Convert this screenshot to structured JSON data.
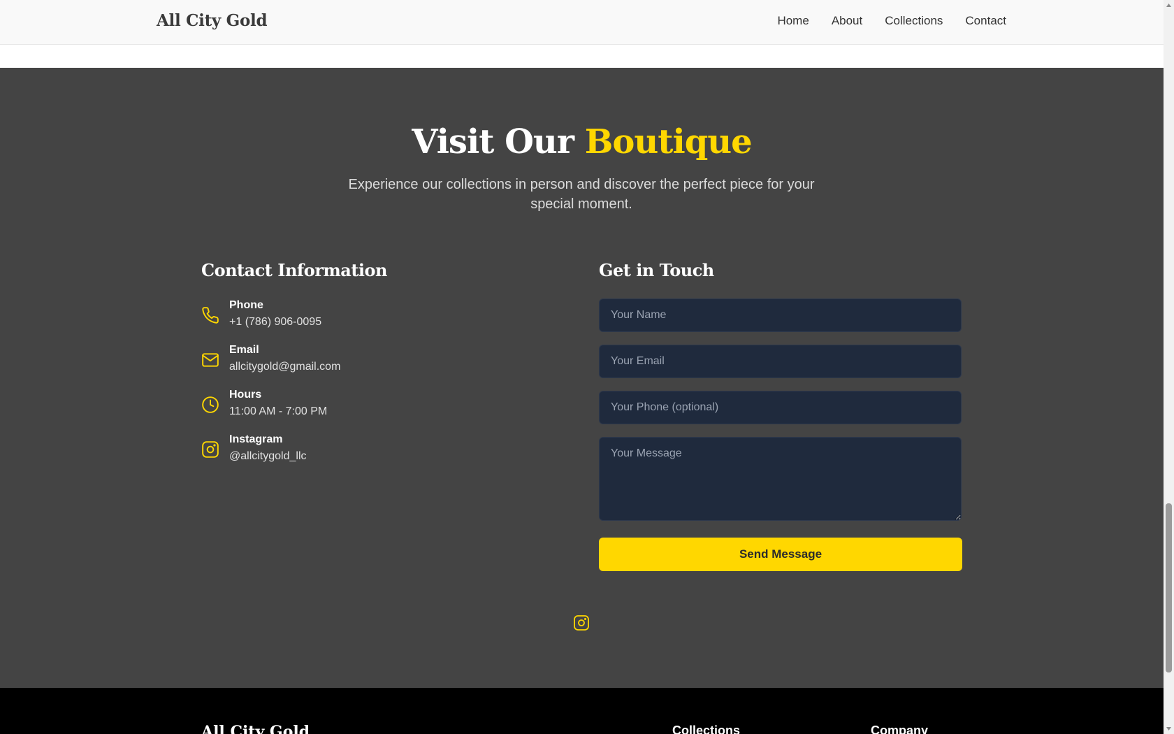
{
  "nav": {
    "brand": "All City Gold",
    "links": [
      "Home",
      "About",
      "Collections",
      "Contact"
    ]
  },
  "hero": {
    "title_main": "Visit Our",
    "title_accent": "Boutique",
    "subtitle": "Experience our collections in person and discover the perfect piece for your special moment."
  },
  "contact_info": {
    "heading": "Contact Information",
    "items": [
      {
        "icon": "phone-icon",
        "label": "Phone",
        "value": "+1 (786) 906-0095"
      },
      {
        "icon": "mail-icon",
        "label": "Email",
        "value": "allcitygold@gmail.com"
      },
      {
        "icon": "clock-icon",
        "label": "Hours",
        "value": "11:00 AM - 7:00 PM"
      },
      {
        "icon": "instagram-icon",
        "label": "Instagram",
        "value": "@allcitygold_llc"
      }
    ]
  },
  "form": {
    "heading": "Get in Touch",
    "name_placeholder": "Your Name",
    "email_placeholder": "Your Email",
    "phone_placeholder": "Your Phone (optional)",
    "message_placeholder": "Your Message",
    "submit_label": "Send Message"
  },
  "footer": {
    "brand": "All City Gold",
    "headings": [
      "Collections",
      "Company"
    ]
  },
  "colors": {
    "accent": "#ffd700",
    "section_bg": "#444444",
    "input_bg": "#1f2a3d",
    "footer_bg": "#000000"
  }
}
